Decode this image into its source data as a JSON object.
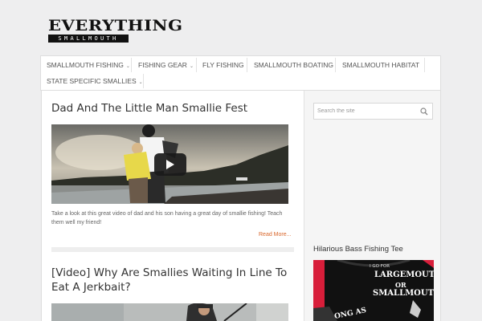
{
  "site": {
    "logo_main": "EVERYTHING",
    "logo_sub": "SMALLMOUTH"
  },
  "nav": {
    "items": [
      {
        "label": "SMALLMOUTH FISHING",
        "has_submenu": true
      },
      {
        "label": "FISHING GEAR",
        "has_submenu": true
      },
      {
        "label": "FLY FISHING",
        "has_submenu": false
      },
      {
        "label": "SMALLMOUTH BOATING",
        "has_submenu": false
      },
      {
        "label": "SMALLMOUTH HABITAT",
        "has_submenu": false
      },
      {
        "label": "STATE SPECIFIC SMALLIES",
        "has_submenu": true
      }
    ],
    "submenu_glyph": "⌄"
  },
  "posts": [
    {
      "title": "Dad And The Little Man Smallie Fest",
      "excerpt": "Take a look at this great video of dad and his son having a great day of smallie fishing! Teach them well my friend!",
      "read_more": "Read More..."
    },
    {
      "title": "[Video] Why Are Smallies Waiting In Line To Eat A Jerkbait?"
    }
  ],
  "sidebar": {
    "search_placeholder": "Search the site",
    "widget_title": "Hilarious Bass Fishing Tee",
    "tee_text": {
      "line1": "I GO FOR",
      "line2": "LARGEMOUTH",
      "line3": "OR",
      "line4": "SMALLMOUTH",
      "line5": "ONG AS"
    }
  },
  "colors": {
    "accent": "#d9662a",
    "page_bg": "#eeeeef",
    "text": "#333333"
  },
  "icons": {
    "search": "search-icon",
    "play": "play-icon"
  }
}
